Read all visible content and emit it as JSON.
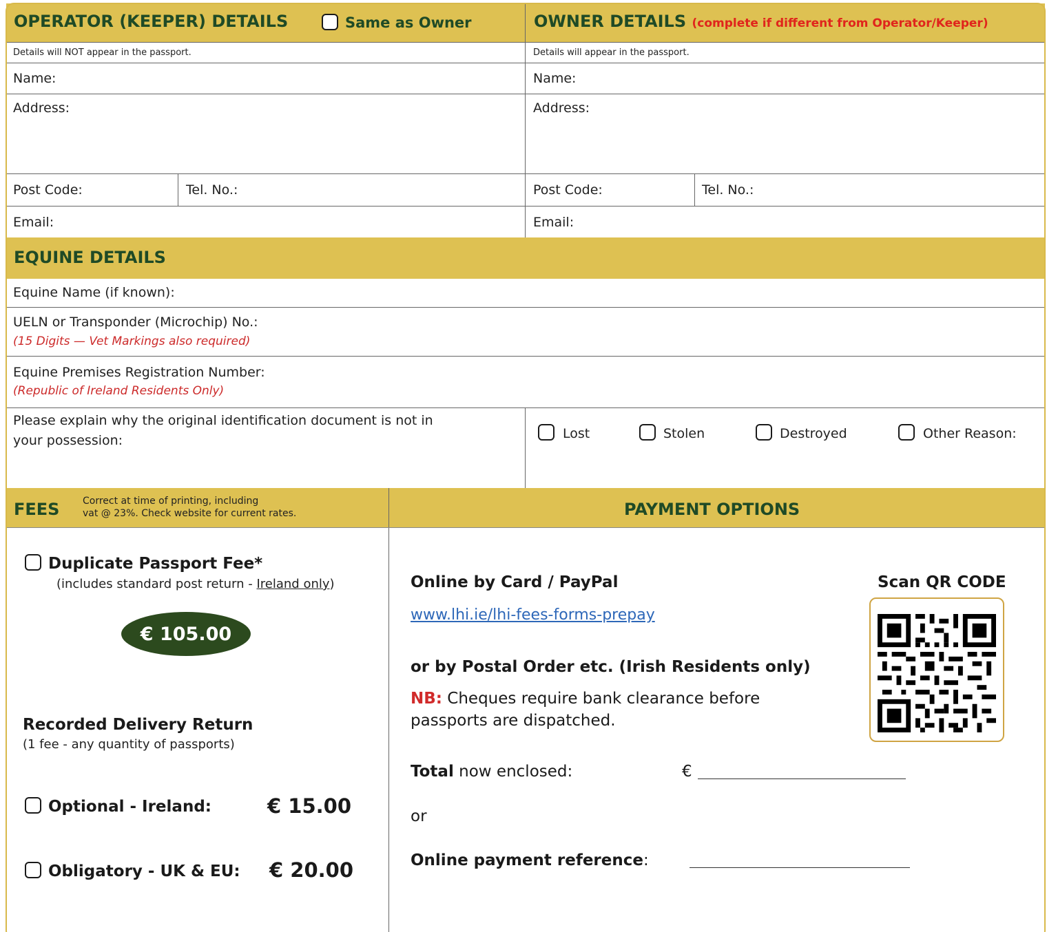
{
  "operator": {
    "title": "OPERATOR (KEEPER) DETAILS",
    "same_as_owner": "Same as Owner",
    "note": "Details will NOT appear in the passport.",
    "name_label": "Name:",
    "address_label": "Address:",
    "postcode_label": "Post Code:",
    "tel_label": "Tel. No.:",
    "email_label": "Email:"
  },
  "owner": {
    "title": "OWNER DETAILS",
    "subtitle": "(complete if different from Operator/Keeper)",
    "note": "Details will appear in the passport.",
    "name_label": "Name:",
    "address_label": "Address:",
    "postcode_label": "Post Code:",
    "tel_label": "Tel. No.:",
    "email_label": "Email:"
  },
  "equine": {
    "title": "EQUINE DETAILS",
    "name_label": "Equine Name (if known):",
    "ueln_label": "UELN or Transponder (Microchip) No.:",
    "ueln_note": "(15 Digits — Vet Markings also required)",
    "premises_label": "Equine Premises Registration Number:",
    "premises_note": "(Republic of Ireland Residents Only)",
    "reason_line1": "Please explain why the original identification document is not in",
    "reason_line2": "your possession:",
    "reasons": [
      "Lost",
      "Stolen",
      "Destroyed",
      "Other Reason:"
    ]
  },
  "fees": {
    "title": "FEES",
    "note_line1": "Correct at time of printing, including",
    "note_line2": "vat @ 23%. Check website for current rates.",
    "duplicate_label": "Duplicate Passport Fee*",
    "duplicate_note_prefix": "(includes standard post return - ",
    "duplicate_note_link": "Ireland only",
    "duplicate_note_suffix": ")",
    "duplicate_price": "€ 105.00",
    "recorded_title": "Recorded Delivery Return",
    "recorded_note": "(1 fee - any quantity of passports)",
    "ireland_label": "Optional - Ireland:",
    "ireland_price": "€ 15.00",
    "ukeu_label": "Obligatory - UK & EU:",
    "ukeu_price": "€ 20.00"
  },
  "payment": {
    "title": "PAYMENT OPTIONS",
    "online_title": "Online by Card / PayPal",
    "online_url": "www.lhi.ie/lhi-fees-forms-prepay",
    "postal_title": "or by Postal Order etc. (Irish Residents only)",
    "nb_label": "NB:",
    "nb_text_line1": " Cheques require bank clearance before",
    "nb_text_line2": "passports are dispatched.",
    "total_bold": "Total",
    "total_rest": " now enclosed:",
    "euro_symbol": "€",
    "or_text": "or",
    "reference_bold": "Online payment reference",
    "reference_colon": ":",
    "qr_title": "Scan QR CODE"
  },
  "colors": {
    "band": "#dec152",
    "header_text": "#1f4a26",
    "accent_red": "#e0251c",
    "pill": "#2c4a1e",
    "link": "#2d67b8"
  }
}
